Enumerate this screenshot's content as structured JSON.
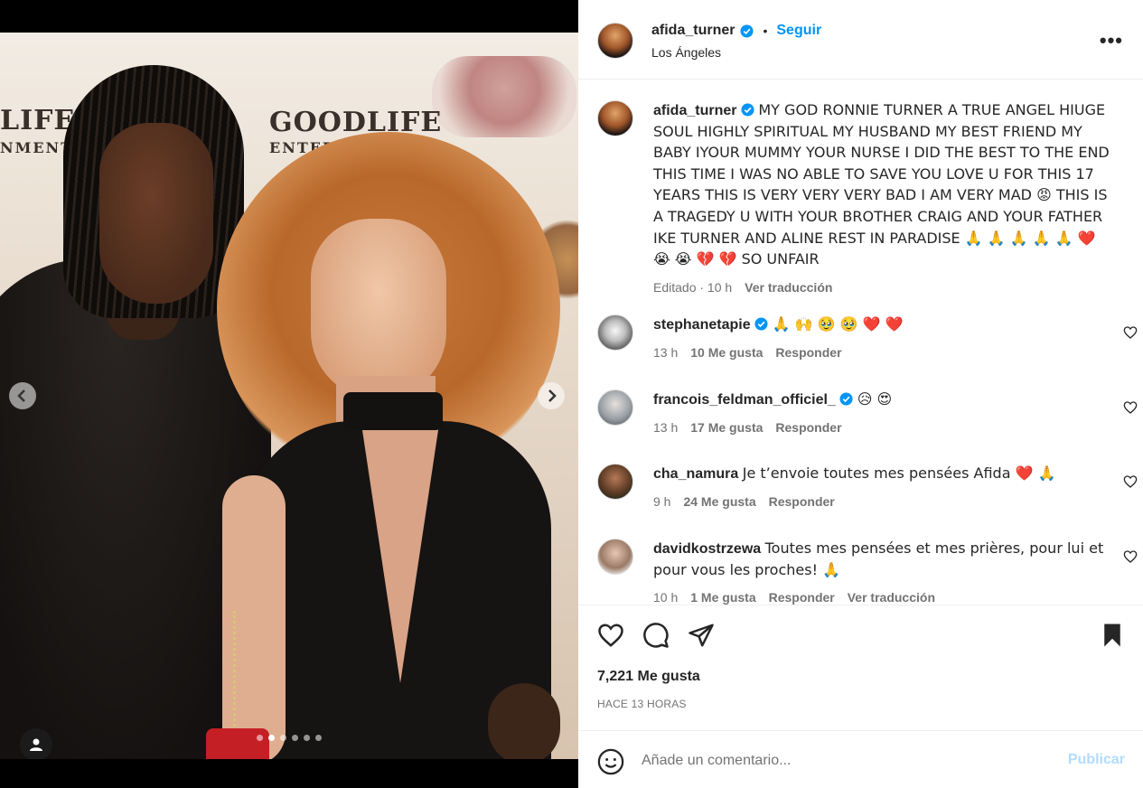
{
  "media": {
    "wall_text": [
      "LIFE",
      "NMENT",
      "GOODLIFE",
      "ENTERTAINMENT"
    ],
    "prev_icon": "chevron-left-icon",
    "next_icon": "chevron-right-icon",
    "carousel": {
      "count": 6,
      "active_index": 1
    }
  },
  "header": {
    "username": "afida_turner",
    "bullet": "•",
    "follow_label": "Seguir",
    "location": "Los Ángeles",
    "more_label": "•••"
  },
  "caption": {
    "username": "afida_turner",
    "text": "MY GOD RONNIE TURNER A TRUE ANGEL HIUGE SOUL HIGHLY SPIRITUAL MY HUSBAND MY BEST FRIEND MY BABY IYOUR MUMMY YOUR NURSE I DID THE BEST TO THE END THIS TIME I WAS NO ABLE TO SAVE YOU LOVE U FOR THIS 17 YEARS THIS IS VERY VERY VERY BAD I AM VERY MAD 😡 THIS IS A TRAGEDY U WITH YOUR BROTHER CRAIG AND YOUR FATHER IKE TURNER AND ALINE REST IN PARADISE 🙏 🙏 🙏 🙏 🙏 ❤️ 😭 😭 💔 💔 SO UNFAIR",
    "edited": "Editado · 10 h",
    "translate": "Ver traducción"
  },
  "comments": [
    {
      "username": "stephanetapie",
      "verified": true,
      "text": "🙏 🙌 🥹 🥹 ❤️ ❤️",
      "time": "13 h",
      "likes": "10 Me gusta",
      "reply": "Responder"
    },
    {
      "username": "francois_feldman_officiel_",
      "verified": true,
      "text": "😥 😍",
      "time": "13 h",
      "likes": "17 Me gusta",
      "reply": "Responder"
    },
    {
      "username": "cha_namura",
      "verified": false,
      "text": "Je t’envoie toutes mes pensées Afida ❤️ 🙏",
      "time": "9 h",
      "likes": "24 Me gusta",
      "reply": "Responder"
    },
    {
      "username": "davidkostrzewa",
      "verified": false,
      "text": "Toutes mes pensées et mes prières, pour lui et pour vous les proches! 🙏",
      "time": "10 h",
      "likes": "1 Me gusta",
      "reply": "Responder",
      "translate": "Ver traducción"
    }
  ],
  "actions": {
    "likes": "7,221 Me gusta",
    "time_ago": "HACE 13 HORAS"
  },
  "composer": {
    "placeholder": "Añade un comentario...",
    "publish_label": "Publicar"
  },
  "colors": {
    "link_blue": "#0095f6",
    "publish_disabled": "#b3dbff",
    "muted": "#737373",
    "verified": "#0095f6"
  }
}
